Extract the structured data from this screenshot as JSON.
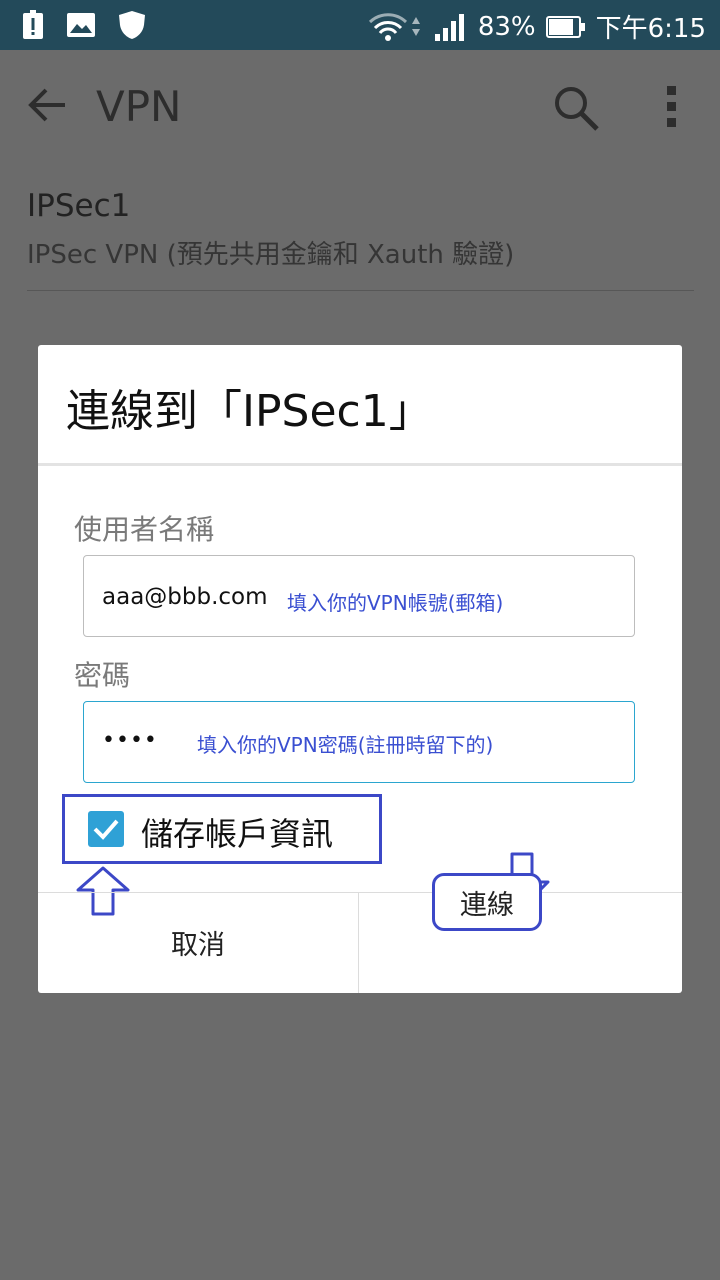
{
  "status_bar": {
    "battery_percent": "83%",
    "time": "下午6:15",
    "icons": [
      "alert-icon",
      "image-icon",
      "shield-icon",
      "wifi-icon",
      "signal-icon",
      "battery-icon"
    ]
  },
  "app_bar": {
    "title": "VPN",
    "icons": [
      "back-arrow-icon",
      "search-icon",
      "more-vert-icon"
    ]
  },
  "vpn_item": {
    "name": "IPSec1",
    "subtitle": "IPSec VPN (預先共用金鑰和 Xauth 驗證)"
  },
  "dialog": {
    "title": "連線到「IPSec1」",
    "username_label": "使用者名稱",
    "username_value": "aaa@bbb.com",
    "username_hint": "填入你的VPN帳號(郵箱)",
    "password_label": "密碼",
    "password_value": "••••",
    "password_hint": "填入你的VPN密碼(註冊時留下的)",
    "save_label": "儲存帳戶資訊",
    "save_checked": true,
    "cancel_label": "取消",
    "connect_label": "連線"
  },
  "colors": {
    "status_bar": "#234a5a",
    "overlay": "#6b6b6b",
    "annotation": "#3c48c7",
    "checkbox": "#2fa1d6",
    "field_focus": "#2ba6cf"
  }
}
